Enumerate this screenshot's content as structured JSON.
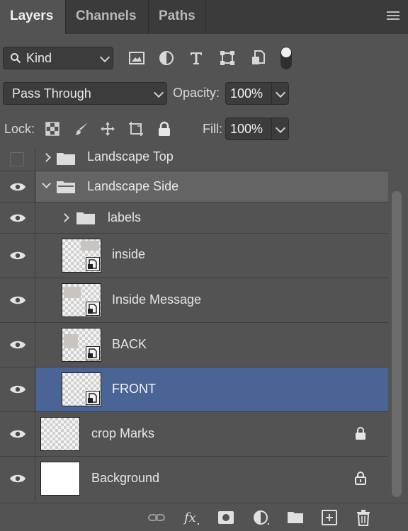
{
  "tabs": [
    {
      "label": "Layers",
      "active": true
    },
    {
      "label": "Channels",
      "active": false
    },
    {
      "label": "Paths",
      "active": false
    }
  ],
  "filter": {
    "kind_label": "Kind",
    "icons": [
      "image-filter-icon",
      "adjustment-filter-icon",
      "type-filter-icon",
      "shape-filter-icon",
      "smart-object-filter-icon"
    ]
  },
  "blend": {
    "mode": "Pass Through",
    "opacity_label": "Opacity:",
    "opacity_value": "100%"
  },
  "lock": {
    "label": "Lock:",
    "fill_label": "Fill:",
    "fill_value": "100%"
  },
  "layers": [
    {
      "name": "Landscape Top",
      "type": "group",
      "visible": false,
      "expanded": false,
      "indent": 0
    },
    {
      "name": "Landscape Side",
      "type": "group",
      "visible": true,
      "expanded": true,
      "indent": 0,
      "highlighted": true
    },
    {
      "name": "labels",
      "type": "group",
      "visible": true,
      "expanded": false,
      "indent": 1
    },
    {
      "name": "inside",
      "type": "smart",
      "visible": true,
      "indent": 1
    },
    {
      "name": "Inside Message",
      "type": "smart",
      "visible": true,
      "indent": 1
    },
    {
      "name": "BACK",
      "type": "smart",
      "visible": true,
      "indent": 1
    },
    {
      "name": "FRONT",
      "type": "smart",
      "visible": true,
      "indent": 1,
      "selected": true
    },
    {
      "name": "crop Marks",
      "type": "pixel",
      "visible": true,
      "indent": 0,
      "locked": true
    },
    {
      "name": "Background",
      "type": "background",
      "visible": true,
      "indent": 0,
      "locked": true
    }
  ],
  "bottom_icons": [
    "link-layers-icon",
    "fx-icon",
    "add-mask-icon",
    "adjustment-layer-icon",
    "new-group-icon",
    "new-layer-icon",
    "delete-layer-icon"
  ],
  "colors": {
    "panel": "#535353",
    "selected_row": "#4a6496",
    "highlight_row": "#646464",
    "tabbar": "#3b3b3b"
  }
}
